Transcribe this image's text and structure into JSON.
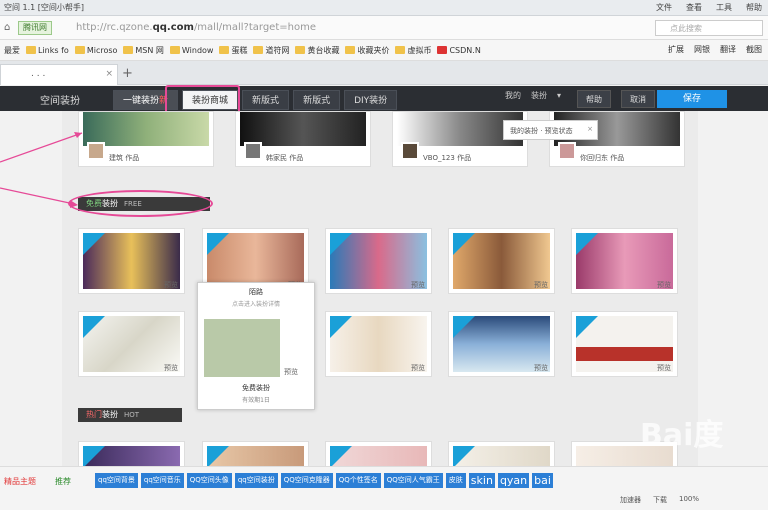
{
  "window": {
    "title": "空间 1.1 [空间小帮手]",
    "menus": [
      "文件",
      "查看",
      "工具",
      "帮助"
    ]
  },
  "addressbar": {
    "secure_label": "腾讯网",
    "url_pre": "http://rc.qzone.",
    "url_domain": "qq.com",
    "url_post": "/mall/mall?target=home",
    "search_placeholder": "点此搜索"
  },
  "bookmarks": {
    "items": [
      "最爱",
      "Links fo",
      "Microso",
      "MSN 网",
      "Window",
      "蛋糕",
      "道符网",
      "黄台收藏",
      "收藏夹价",
      "虚拟币",
      "CSDN.N"
    ],
    "right": [
      "扩展",
      "网银",
      "翻译",
      "截图"
    ]
  },
  "tab": {
    "label": ". . .",
    "close": "×",
    "new": "+"
  },
  "site": {
    "logo": "空间装扮",
    "nav": [
      {
        "label": "一键装扮",
        "badge": "新"
      },
      {
        "label": "装扮商城"
      },
      {
        "label": "新版式"
      },
      {
        "label": "新版式"
      },
      {
        "label": "DIY装扮"
      }
    ],
    "header_right": [
      "我的",
      "装扮",
      "▾"
    ],
    "help": "帮助",
    "cancel": "取消",
    "save": "保存"
  },
  "tooltip": {
    "text": "我的装扮 · 预览状态",
    "close": "×"
  },
  "top_row": [
    {
      "author": "建筑",
      "suffix": "作品"
    },
    {
      "author": "韩家民",
      "suffix": "作品"
    },
    {
      "author": "VBO_123",
      "suffix": "作品"
    },
    {
      "author": "你回归东",
      "suffix": "作品"
    }
  ],
  "sections": {
    "free": {
      "cn": "免费",
      "rest": "装扮",
      "en": "FREE"
    },
    "hot": {
      "cn": "热门",
      "rest": "装扮",
      "en": "HOT"
    }
  },
  "card_foot": "预览",
  "popup": {
    "title": "陌路",
    "subtitle": "点击进入装扮详情",
    "name": "免费装扮",
    "sub": "有效期1日",
    "btn": "预览"
  },
  "status": {
    "left": "精品主题",
    "second": "推荐",
    "links": [
      "qq空间背景",
      "qq空间音乐",
      "QQ空间头像",
      "qq空间装扮",
      "QQ空间克隆器",
      "QQ个性签名",
      "QQ空间人气霸王",
      "皮肤"
    ],
    "big": [
      "skin",
      "qyan",
      "bai"
    ],
    "right": [
      "加速器",
      "下载",
      "100%"
    ]
  },
  "watermark": "Bai度",
  "colors": {
    "header_bg": "#2b2e33",
    "save_blue": "#1f92e6",
    "highlight_pink": "#e64a97",
    "corner_blue": "#1aa0d8",
    "link_blue": "#2c7fd6"
  }
}
